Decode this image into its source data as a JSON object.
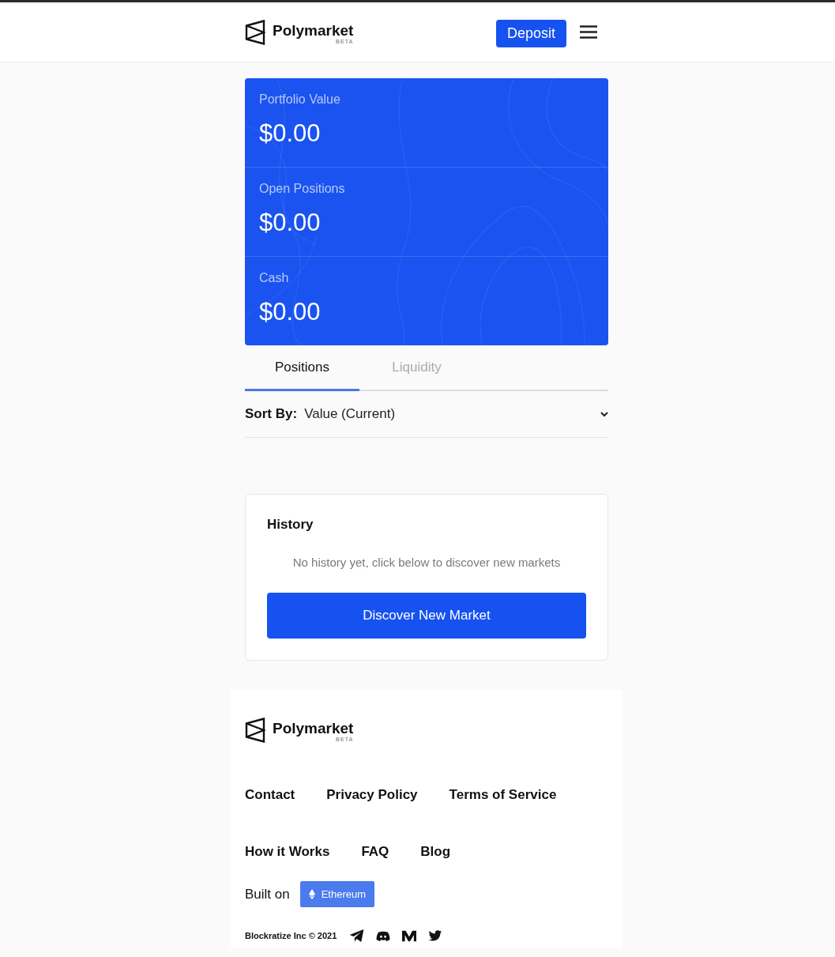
{
  "header": {
    "logo": {
      "name": "Polymarket",
      "badge": "BETA"
    },
    "deposit_button": "Deposit"
  },
  "summary_card": {
    "items": [
      {
        "label": "Portfolio Value",
        "value": "$0.00"
      },
      {
        "label": "Open Positions",
        "value": "$0.00"
      },
      {
        "label": "Cash",
        "value": "$0.00"
      }
    ]
  },
  "tabs": [
    {
      "label": "Positions",
      "selected": true
    },
    {
      "label": "Liquidity",
      "selected": false
    }
  ],
  "sort": {
    "label": "Sort By:",
    "value": "Value (Current)"
  },
  "history": {
    "title": "History",
    "message": "No history yet, click below to discover new markets",
    "button": "Discover New Market"
  },
  "footer": {
    "logo": {
      "name": "Polymarket",
      "badge": "BETA"
    },
    "link_rows": [
      [
        "Contact",
        "Privacy Policy",
        "Terms of Service"
      ],
      [
        "How it Works",
        "FAQ",
        "Blog"
      ]
    ],
    "built_on": {
      "label": "Built on",
      "badge": "Ethereum"
    },
    "copyright": "Blockratize Inc © 2021"
  }
}
